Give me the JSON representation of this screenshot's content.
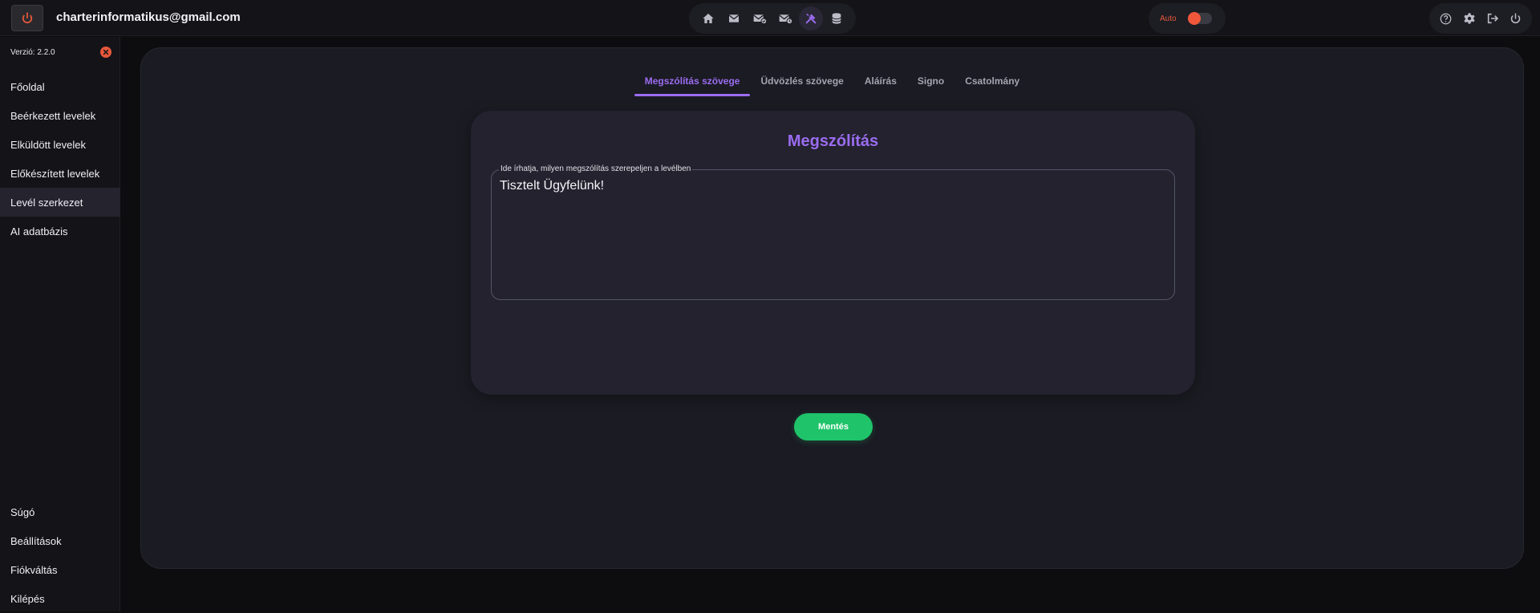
{
  "header": {
    "account_email": "charterinformatikus@gmail.com",
    "nav_icons": [
      "home-icon",
      "mail-icon",
      "mail-check-icon",
      "mail-clock-icon",
      "tools-icon",
      "database-icon"
    ],
    "active_nav": "tools-icon",
    "theme_label": "Auto",
    "theme_toggle_color": "#f0573a",
    "util_icons": [
      "help-icon",
      "gear-icon",
      "logout-icon",
      "power-icon"
    ]
  },
  "sidebar": {
    "version": "Verzió: 2.2.0",
    "items": [
      {
        "label": "Főoldal"
      },
      {
        "label": "Beérkezett levelek"
      },
      {
        "label": "Elküldött levelek"
      },
      {
        "label": "Előkészített levelek"
      },
      {
        "label": "Levél szerkezet"
      },
      {
        "label": "AI adatbázis"
      }
    ],
    "active_item": "Levél szerkezet",
    "bottom_items": [
      {
        "label": "Súgó"
      },
      {
        "label": "Beállítások"
      },
      {
        "label": "Fiókváltás"
      },
      {
        "label": "Kilépés"
      }
    ]
  },
  "main": {
    "tabs": [
      {
        "label": "Megszólítás szövege"
      },
      {
        "label": "Üdvözlés szövege"
      },
      {
        "label": "Aláírás"
      },
      {
        "label": "Signo"
      },
      {
        "label": "Csatolmány"
      }
    ],
    "active_tab": "Megszólítás szövege",
    "card_title": "Megszólítás",
    "field_label": "Ide írhatja, milyen megszólítás szerepeljen a levélben",
    "field_value": "Tisztelt Ügyfelünk!",
    "save_label": "Mentés"
  },
  "colors": {
    "accent": "#9b6cf0",
    "save": "#1fc46a",
    "danger": "#e8573a"
  }
}
